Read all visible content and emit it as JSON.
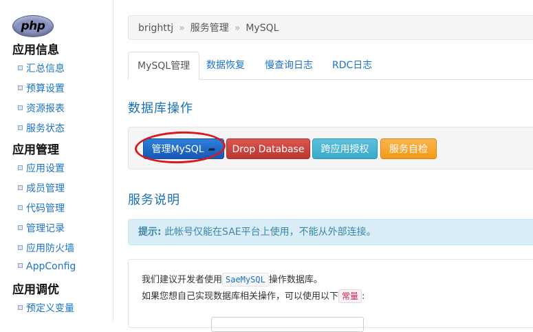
{
  "sidebar": {
    "logo_text": "php",
    "sections": [
      {
        "title": "应用信息",
        "items": [
          "汇总信息",
          "预算设置",
          "资源报表",
          "服务状态"
        ]
      },
      {
        "title": "应用管理",
        "items": [
          "应用设置",
          "成员管理",
          "代码管理",
          "管理记录",
          "应用防火墙",
          "AppConfig"
        ]
      },
      {
        "title": "应用调优",
        "items": [
          "预定义变量"
        ]
      }
    ]
  },
  "breadcrumb": [
    "brighttj",
    "服务管理",
    "MySQL"
  ],
  "breadcrumb_sep": "»",
  "tabs": [
    "MySQL管理",
    "数据恢复",
    "慢查询日志",
    "RDC日志"
  ],
  "active_tab": "MySQL管理",
  "ops": {
    "title": "数据库操作",
    "buttons": {
      "manage": "管理MySQL",
      "drop": "Drop Database",
      "cross": "跨应用授权",
      "check": "服务自检"
    },
    "manage_icon": "arrow-right-icon"
  },
  "service": {
    "title": "服务说明",
    "alert_label": "提示:",
    "alert_text": "此帐号仅能在SAE平台上使用，不能从外部连接。",
    "line1_pre": "我们建议开发者使用",
    "line1_code": "SaeMySQL",
    "line1_post": "操作数据库。",
    "line2_pre": "如果您想自己实现数据库相关操作，可以使用以下",
    "line2_code": "常量",
    "line2_post": ":"
  },
  "colors": {
    "link": "#1a73c8",
    "primary": "#1559b5",
    "danger": "#bd3631",
    "info": "#3aa9c9",
    "warning": "#f49a18",
    "highlight_ring": "#d71920"
  }
}
